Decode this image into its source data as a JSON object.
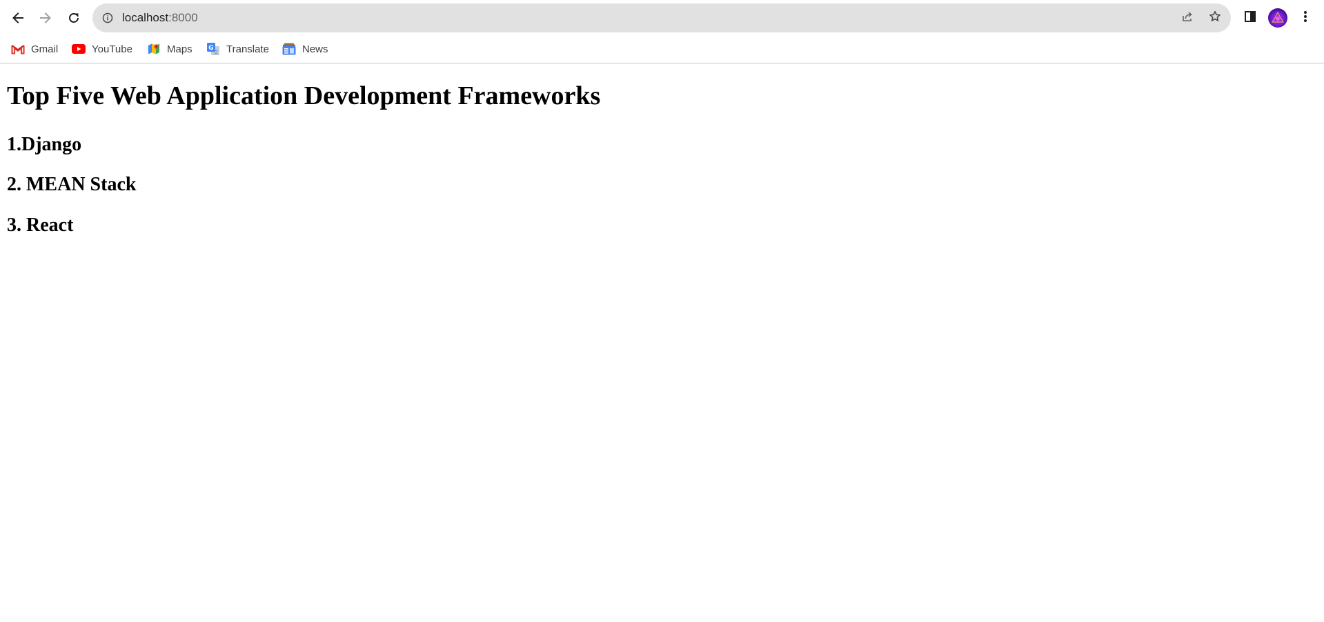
{
  "browser": {
    "url_host": "localhost",
    "url_port": ":8000",
    "bookmarks": [
      {
        "label": "Gmail",
        "icon": "gmail-icon"
      },
      {
        "label": "YouTube",
        "icon": "youtube-icon"
      },
      {
        "label": "Maps",
        "icon": "maps-icon"
      },
      {
        "label": "Translate",
        "icon": "translate-icon"
      },
      {
        "label": "News",
        "icon": "news-icon"
      }
    ],
    "icons": {
      "back": "arrow-left-icon",
      "forward": "arrow-right-icon",
      "reload": "reload-icon",
      "site_info": "info-icon",
      "share": "share-icon",
      "bookmark_star": "star-icon",
      "side_panel": "side-panel-icon",
      "menu": "more-vert-icon"
    },
    "colors": {
      "omnibox_bg": "#e1e1e1",
      "avatar_accent": "#7b1fd6"
    }
  },
  "page": {
    "title": "Top Five Web Application Development Frameworks",
    "frameworks": [
      {
        "text": "1.Django"
      },
      {
        "text": "2. MEAN Stack"
      },
      {
        "text": "3. React"
      }
    ]
  }
}
